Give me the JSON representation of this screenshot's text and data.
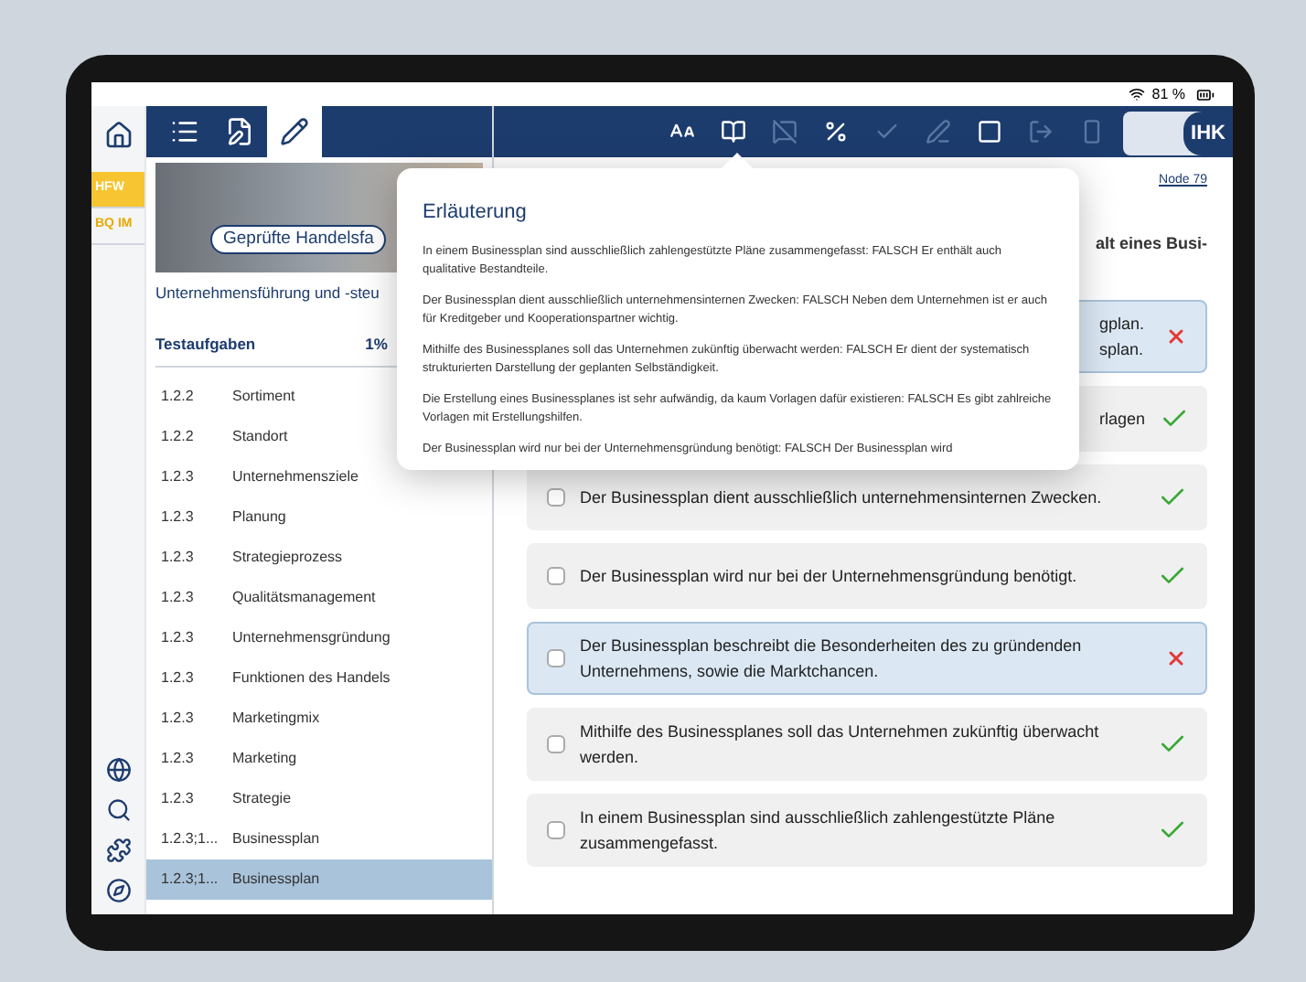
{
  "status_bar": {
    "battery": "81 %"
  },
  "rail": {
    "tiles": [
      {
        "label": "HFW",
        "selected": true
      },
      {
        "label": "BQ IM",
        "selected": false
      }
    ]
  },
  "sidebar": {
    "tabs": [
      {
        "kind": "list",
        "selected": false
      },
      {
        "kind": "edit",
        "selected": false
      },
      {
        "kind": "pencil",
        "selected": true
      }
    ],
    "banner_title": "Geprüfte Handelsfa",
    "subtitle": "Unternehmensführung und -steu",
    "header": {
      "title": "Testaufgaben",
      "progress": "1%"
    },
    "items": [
      {
        "number": "1.2.2",
        "title": "Sortiment",
        "selected": false
      },
      {
        "number": "1.2.2",
        "title": "Standort",
        "selected": false
      },
      {
        "number": "1.2.3",
        "title": "Unternehmensziele",
        "selected": false
      },
      {
        "number": "1.2.3",
        "title": "Planung",
        "selected": false
      },
      {
        "number": "1.2.3",
        "title": "Strategieprozess",
        "selected": false
      },
      {
        "number": "1.2.3",
        "title": "Qualitätsmanagement",
        "selected": false
      },
      {
        "number": "1.2.3",
        "title": "Unternehmensgründung",
        "selected": false
      },
      {
        "number": "1.2.3",
        "title": "Funktionen des Handels",
        "selected": false
      },
      {
        "number": "1.2.3",
        "title": "Marketingmix",
        "selected": false
      },
      {
        "number": "1.2.3",
        "title": "Marketing",
        "selected": false
      },
      {
        "number": "1.2.3",
        "title": "Strategie",
        "selected": false
      },
      {
        "number": "1.2.3;1...",
        "title": "Businessplan",
        "selected": false
      },
      {
        "number": "1.2.3;1...",
        "title": "Businessplan",
        "selected": true
      }
    ]
  },
  "toolbar": {
    "tools": [
      {
        "kind": "font",
        "disabled": false
      },
      {
        "kind": "book",
        "disabled": false
      },
      {
        "kind": "comment",
        "disabled": true
      },
      {
        "kind": "fraction",
        "disabled": false
      },
      {
        "kind": "check",
        "disabled": true
      },
      {
        "kind": "pen",
        "disabled": true
      },
      {
        "kind": "page",
        "disabled": false
      },
      {
        "kind": "exit",
        "disabled": true
      },
      {
        "kind": "bar",
        "disabled": true
      }
    ],
    "logo": "IHK"
  },
  "content": {
    "node_link": "Node 79",
    "question": "alt eines Busi-",
    "answers": [
      {
        "kind": "fragment",
        "text": "gplan.\nsplan.",
        "selected": true,
        "correct": false
      },
      {
        "kind": "fragment",
        "text": "rlagen",
        "selected": false,
        "correct": true
      },
      {
        "kind": "option",
        "text": "Der Businessplan dient ausschließlich unternehmensinternen Zwecken.",
        "selected": false,
        "correct": true
      },
      {
        "kind": "option",
        "text": "Der Businessplan wird nur bei der Unternehmensgründung benötigt.",
        "selected": false,
        "correct": true
      },
      {
        "kind": "option",
        "text": "Der Businessplan beschreibt die Besonderheiten des zu gründenden Unternehmens, sowie die Marktchancen.",
        "selected": true,
        "correct": false
      },
      {
        "kind": "option",
        "text": "Mithilfe des Businessplanes soll das Unternehmen zukünftig überwacht werden.",
        "selected": false,
        "correct": true
      },
      {
        "kind": "option",
        "text": "In einem Businessplan sind ausschließlich zahlengestützte Pläne zusammengefasst.",
        "selected": false,
        "correct": true
      }
    ]
  },
  "popover": {
    "title": "Erläuterung",
    "paragraphs": [
      "In einem Businessplan sind ausschließlich zahlengestützte Pläne zusammengefasst: FALSCH Er enthält auch qualitative Bestandteile.",
      "Der Businessplan dient ausschließlich unternehmensinternen Zwecken: FALSCH Neben dem Unternehmen ist er auch für Kreditgeber und Kooperationspartner wichtig.",
      "Mithilfe des Businessplanes soll das Unternehmen zukünftig überwacht werden: FALSCH Er dient der systematisch strukturierten Darstellung der geplanten Selbständigkeit.",
      "Die Erstellung eines Businessplanes ist sehr aufwändig, da kaum Vorlagen dafür existieren: FALSCH Es gibt zahlreiche Vorlagen mit Erstellungshilfen.",
      "Der Businessplan wird nur bei der Unternehmensgründung benötigt: FALSCH Der Businessplan wird"
    ]
  }
}
